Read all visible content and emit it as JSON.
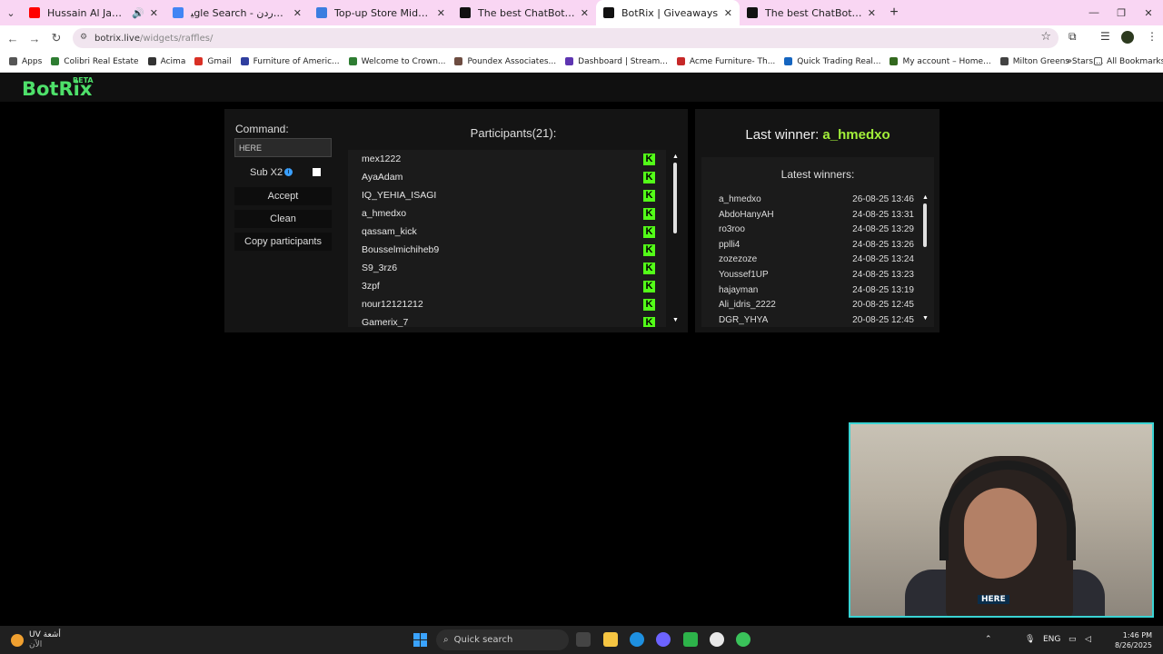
{
  "browser": {
    "tabs": [
      {
        "title": "Hussain Al Jassmi – Al Shat",
        "fav": "#ff0000",
        "icon": "youtube-icon",
        "extra": "🔊"
      },
      {
        "title": "ﯿgle Search - درجات الحرارة الاردن",
        "fav": "#4285f4",
        "icon": "google-icon"
      },
      {
        "title": "Top-up Store Midasbuy United",
        "fav": "#3b7de0",
        "icon": "midasbuy-icon"
      },
      {
        "title": "The best ChatBot and Widgets",
        "fav": "#111111",
        "icon": "botrix-icon"
      },
      {
        "title": "BotRix | Giveaways",
        "fav": "#111111",
        "icon": "botrix-icon",
        "active": true
      },
      {
        "title": "The best ChatBot and Widgets",
        "fav": "#111111",
        "icon": "botrix-icon"
      }
    ],
    "url_host": "botrix.live",
    "url_path": "/widgets/raffles/",
    "bookmarks": [
      {
        "label": "Apps",
        "color": "#555555"
      },
      {
        "label": "Colibri Real Estate",
        "color": "#2e7d32"
      },
      {
        "label": "Acima",
        "color": "#333333"
      },
      {
        "label": "Gmail",
        "color": "#d93025"
      },
      {
        "label": "Furniture of Americ...",
        "color": "#303f9f"
      },
      {
        "label": "Welcome to Crown...",
        "color": "#2e7d32"
      },
      {
        "label": "Poundex Associates...",
        "color": "#6d4c41"
      },
      {
        "label": "Dashboard | Stream...",
        "color": "#5e35b1"
      },
      {
        "label": "Acme Furniture- Th...",
        "color": "#c62828"
      },
      {
        "label": "Quick Trading Real...",
        "color": "#1565c0"
      },
      {
        "label": "My account – Home...",
        "color": "#33691e"
      },
      {
        "label": "Milton Greens Stars,...",
        "color": "#424242"
      }
    ],
    "all_bookmarks": "All Bookmarks"
  },
  "app": {
    "logo": "BotRix",
    "logo_badge": "BETA",
    "command_label": "Command:",
    "command_value": "HERE",
    "sub_label": "Sub X2",
    "buttons": {
      "accept": "Accept",
      "clean": "Clean",
      "copy": "Copy participants"
    },
    "participants_title": "Participants(21):",
    "participants": [
      "mex1222",
      "AyaAdam",
      "IQ_YEHIA_ISAGI",
      "a_hmedxo",
      "qassam_kick",
      "Bousselmichiheb9",
      "S9_3rz6",
      "3zpf",
      "nour12121212",
      "Gamerix_7"
    ],
    "last_winner_label": "Last winner:",
    "last_winner_name": "a_hmedxo",
    "latest_winners_title": "Latest winners:",
    "winners": [
      {
        "name": "a_hmedxo",
        "date": "26-08-25 13:46"
      },
      {
        "name": "AbdoHanyAH",
        "date": "24-08-25 13:31"
      },
      {
        "name": "ro3roo",
        "date": "24-08-25 13:29"
      },
      {
        "name": "pplli4",
        "date": "24-08-25 13:26"
      },
      {
        "name": "zozezoze",
        "date": "24-08-25 13:24"
      },
      {
        "name": "Youssef1UP",
        "date": "24-08-25 13:23"
      },
      {
        "name": "hajayman",
        "date": "24-08-25 13:19"
      },
      {
        "name": "Ali_idris_2222",
        "date": "20-08-25 12:45"
      },
      {
        "name": "DGR_YHYA",
        "date": "20-08-25 12:45"
      }
    ],
    "webcam_tag": "HERE"
  },
  "taskbar": {
    "weather_temp": "UV",
    "weather_text": "أشعة",
    "weather_sub": "الآن",
    "search": "Quick search",
    "lang": "ENG",
    "time": "1:46 PM",
    "date": "8/26/2025"
  }
}
